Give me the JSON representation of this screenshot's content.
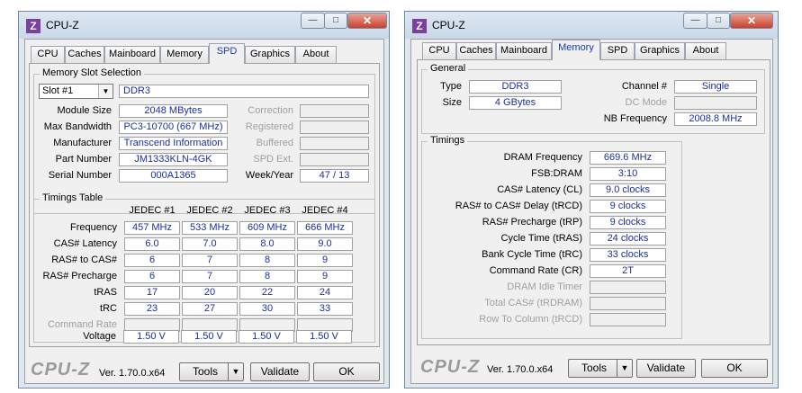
{
  "left": {
    "title": "CPU-Z",
    "icon_letter": "Z",
    "tabs": [
      "CPU",
      "Caches",
      "Mainboard",
      "Memory",
      "SPD",
      "Graphics",
      "About"
    ],
    "active_tab": "SPD",
    "slot_group": "Memory Slot Selection",
    "slot_select": "Slot #1",
    "slot_type": "DDR3",
    "labels": {
      "module_size": "Module Size",
      "max_bandwidth": "Max Bandwidth",
      "manufacturer": "Manufacturer",
      "part_number": "Part Number",
      "serial_number": "Serial Number",
      "correction": "Correction",
      "registered": "Registered",
      "buffered": "Buffered",
      "spd_ext": "SPD Ext.",
      "week_year": "Week/Year"
    },
    "values": {
      "module_size": "2048 MBytes",
      "max_bandwidth": "PC3-10700 (667 MHz)",
      "manufacturer": "Transcend Information",
      "part_number": "JM1333KLN-4GK",
      "serial_number": "000A1365",
      "correction": "",
      "registered": "",
      "buffered": "",
      "spd_ext": "",
      "week_year": "47 / 13"
    },
    "timings_group": "Timings Table",
    "jedec_headers": [
      "JEDEC #1",
      "JEDEC #2",
      "JEDEC #3",
      "JEDEC #4"
    ],
    "timing_rows": [
      {
        "label": "Frequency",
        "values": [
          "457 MHz",
          "533 MHz",
          "609 MHz",
          "666 MHz"
        ]
      },
      {
        "label": "CAS# Latency",
        "values": [
          "6.0",
          "7.0",
          "8.0",
          "9.0"
        ]
      },
      {
        "label": "RAS# to CAS#",
        "values": [
          "6",
          "7",
          "8",
          "9"
        ]
      },
      {
        "label": "RAS# Precharge",
        "values": [
          "6",
          "7",
          "8",
          "9"
        ]
      },
      {
        "label": "tRAS",
        "values": [
          "17",
          "20",
          "22",
          "24"
        ]
      },
      {
        "label": "tRC",
        "values": [
          "23",
          "27",
          "30",
          "33"
        ]
      },
      {
        "label": "Command Rate",
        "values": [
          "",
          "",
          "",
          ""
        ]
      },
      {
        "label": "Voltage",
        "values": [
          "1.50 V",
          "1.50 V",
          "1.50 V",
          "1.50 V"
        ]
      }
    ],
    "footer": {
      "logo": "CPU-Z",
      "version": "Ver. 1.70.0.x64",
      "tools": "Tools",
      "validate": "Validate",
      "ok": "OK"
    }
  },
  "right": {
    "title": "CPU-Z",
    "icon_letter": "Z",
    "tabs": [
      "CPU",
      "Caches",
      "Mainboard",
      "Memory",
      "SPD",
      "Graphics",
      "About"
    ],
    "active_tab": "Memory",
    "general_group": "General",
    "general": {
      "type_label": "Type",
      "type_value": "DDR3",
      "size_label": "Size",
      "size_value": "4 GBytes",
      "channel_label": "Channel #",
      "channel_value": "Single",
      "dc_mode_label": "DC Mode",
      "dc_mode_value": "",
      "nb_freq_label": "NB Frequency",
      "nb_freq_value": "2008.8 MHz"
    },
    "timings_group": "Timings",
    "timings": [
      {
        "label": "DRAM Frequency",
        "value": "669.6 MHz"
      },
      {
        "label": "FSB:DRAM",
        "value": "3:10"
      },
      {
        "label": "CAS# Latency (CL)",
        "value": "9.0 clocks"
      },
      {
        "label": "RAS# to CAS# Delay (tRCD)",
        "value": "9 clocks"
      },
      {
        "label": "RAS# Precharge (tRP)",
        "value": "9 clocks"
      },
      {
        "label": "Cycle Time (tRAS)",
        "value": "24 clocks"
      },
      {
        "label": "Bank Cycle Time (tRC)",
        "value": "33 clocks"
      },
      {
        "label": "Command Rate (CR)",
        "value": "2T"
      },
      {
        "label": "DRAM Idle Timer",
        "value": ""
      },
      {
        "label": "Total CAS# (tRDRAM)",
        "value": ""
      },
      {
        "label": "Row To Column (tRCD)",
        "value": ""
      }
    ],
    "footer": {
      "logo": "CPU-Z",
      "version": "Ver. 1.70.0.x64",
      "tools": "Tools",
      "validate": "Validate",
      "ok": "OK"
    }
  }
}
